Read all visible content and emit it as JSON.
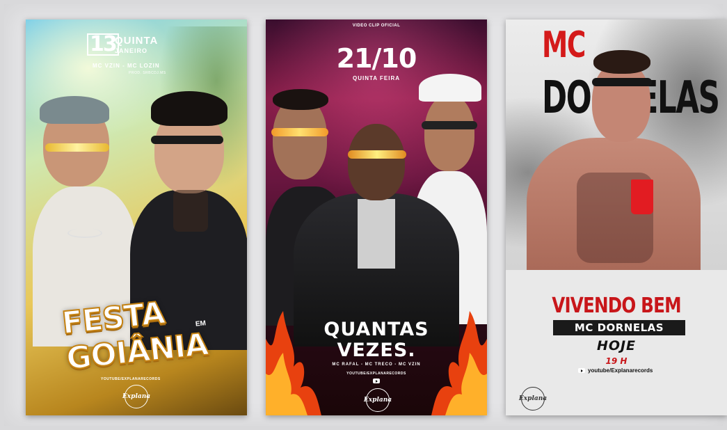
{
  "posters": [
    {
      "date_number": "13",
      "weekday": "QUINTA",
      "month": "JANEIRO",
      "artists": "MC VZIN - MC LOZIN",
      "producer": "PROD. SRBCDJ.MS",
      "title_line1": "FESTA",
      "title_connector": "EM",
      "title_line2": "GOIÂNIA",
      "channel": "YOUTUBE/EXPLANARECORDS",
      "logo": "Explana"
    },
    {
      "label": "VIDEO CLIP OFICIAL",
      "date": "21/10",
      "weekday": "QUINTA FEIRA",
      "title_line1": "QUANTAS",
      "title_line2": "VEZES.",
      "artists": "MC RAFAL - MC TRECO - MC VZIN",
      "channel": "YOUTUBE/EXPLANARECORDS",
      "logo": "Explana"
    },
    {
      "name_top": "MC",
      "name_bottom": "DORNELAS",
      "song": "VIVENDO BEM",
      "artist_bar": "MC DORNELAS",
      "day": "HOJE",
      "time": "19 H",
      "channel": "youtube/Explanarecords",
      "logo": "Explana"
    }
  ],
  "colors": {
    "accent_red": "#c8161a",
    "gold": "#c58212"
  }
}
